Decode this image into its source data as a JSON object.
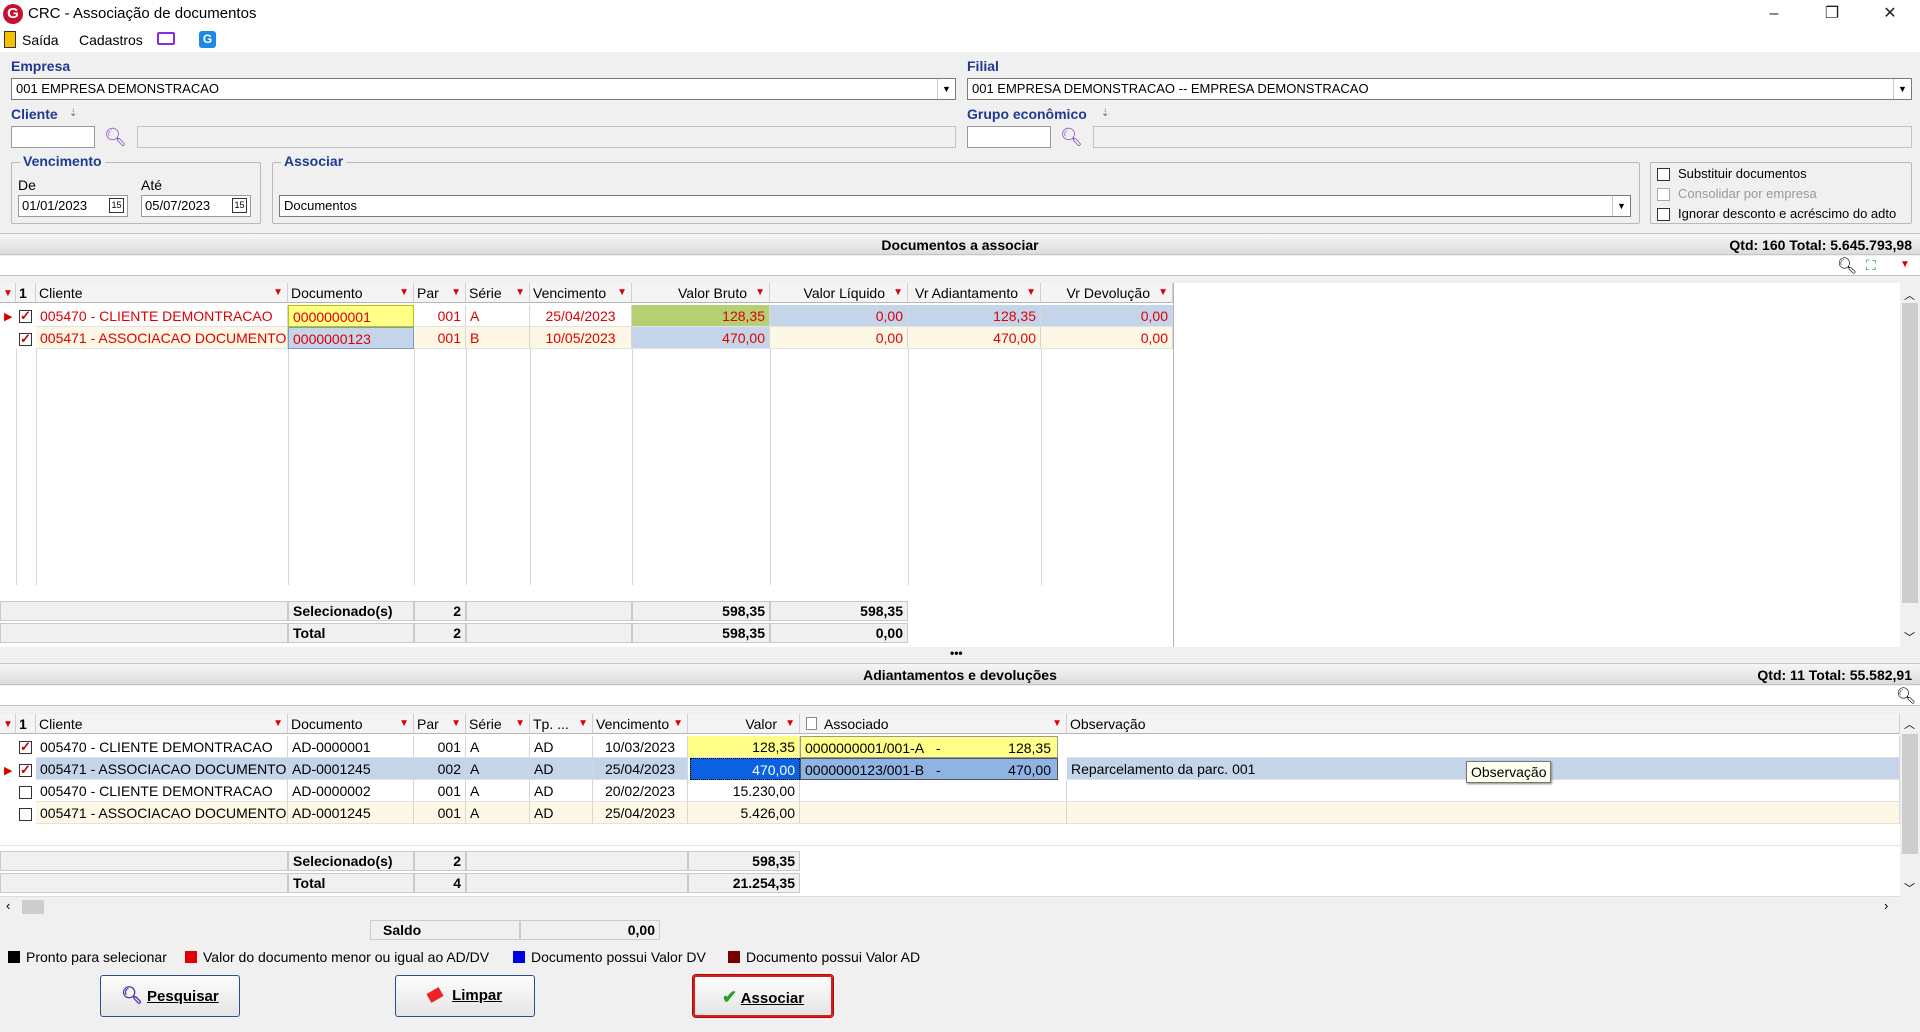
{
  "window": {
    "title": "CRC - Associação de documentos",
    "logo": "G"
  },
  "menu": {
    "saida": "Saída",
    "cadastros": "Cadastros"
  },
  "empresa": {
    "label": "Empresa",
    "value": "001 EMPRESA DEMONSTRACAO"
  },
  "filial": {
    "label": "Filial",
    "value": "001 EMPRESA DEMONSTRACAO -- EMPRESA DEMONSTRACAO"
  },
  "cliente": {
    "label": "Cliente"
  },
  "grupo": {
    "label": "Grupo econômico"
  },
  "vencimento": {
    "label": "Vencimento",
    "de_label": "De",
    "ate_label": "Até",
    "de": "01/01/2023",
    "ate": "05/07/2023"
  },
  "associar": {
    "label": "Associar",
    "value": "Documentos"
  },
  "options": {
    "substituir": "Substituir documentos",
    "consolidar": "Consolidar por empresa",
    "ignorar": "Ignorar desconto e acréscimo do adto"
  },
  "docs": {
    "title": "Documentos a associar",
    "summary": "Qtd: 160 Total: 5.645.793,98",
    "columns": {
      "num": "1",
      "cliente": "Cliente",
      "documento": "Documento",
      "par": "Par",
      "serie": "Série",
      "vencimento": "Vencimento",
      "valor_bruto": "Valor Bruto",
      "valor_liquido": "Valor Líquido",
      "vr_adiantamento": "Vr Adiantamento",
      "vr_devolucao": "Vr Devolução"
    },
    "rows": [
      {
        "cliente": "005470 - CLIENTE DEMONTRACAO",
        "documento": "0000000001",
        "par": "001",
        "serie": "A",
        "vencimento": "25/04/2023",
        "valor_bruto": "128,35",
        "valor_liquido": "0,00",
        "vr_adiantamento": "128,35",
        "vr_devolucao": "0,00"
      },
      {
        "cliente": "005471 - ASSOCIACAO DOCUMENTO",
        "documento": "0000000123",
        "par": "001",
        "serie": "B",
        "vencimento": "10/05/2023",
        "valor_bruto": "470,00",
        "valor_liquido": "0,00",
        "vr_adiantamento": "470,00",
        "vr_devolucao": "0,00"
      }
    ],
    "footer": {
      "sel_label": "Selecionado(s)",
      "sel_count": "2",
      "sel_bruto": "598,35",
      "sel_liquido": "598,35",
      "tot_label": "Total",
      "tot_count": "2",
      "tot_bruto": "598,35",
      "tot_liquido": "0,00"
    }
  },
  "splitter": "•••",
  "adt": {
    "title": "Adiantamentos e devoluções",
    "summary": "Qtd: 11 Total: 55.582,91",
    "columns": {
      "num": "1",
      "cliente": "Cliente",
      "documento": "Documento",
      "par": "Par",
      "serie": "Série",
      "tp": "Tp. ...",
      "vencimento": "Vencimento",
      "valor": "Valor",
      "associado": "Associado",
      "observacao": "Observação"
    },
    "rows": [
      {
        "cliente": "005470 - CLIENTE DEMONTRACAO",
        "documento": "AD-0000001",
        "par": "001",
        "serie": "A",
        "tp": "AD",
        "vencimento": "10/03/2023",
        "valor": "128,35",
        "associado": "0000000001/001-A",
        "sep": "-",
        "assoc_valor": "128,35",
        "observacao": ""
      },
      {
        "cliente": "005471 - ASSOCIACAO DOCUMENTO",
        "documento": "AD-0001245",
        "par": "002",
        "serie": "A",
        "tp": "AD",
        "vencimento": "25/04/2023",
        "valor": "470,00",
        "associado": "0000000123/001-B",
        "sep": "-",
        "assoc_valor": "470,00",
        "observacao": "Reparcelamento da parc. 001"
      },
      {
        "cliente": "005470 - CLIENTE DEMONTRACAO",
        "documento": "AD-0000002",
        "par": "001",
        "serie": "A",
        "tp": "AD",
        "vencimento": "20/02/2023",
        "valor": "15.230,00",
        "associado": "",
        "sep": "",
        "assoc_valor": "",
        "observacao": ""
      },
      {
        "cliente": "005471 - ASSOCIACAO DOCUMENTO",
        "documento": "AD-0001245",
        "par": "001",
        "serie": "A",
        "tp": "AD",
        "vencimento": "25/04/2023",
        "valor": "5.426,00",
        "associado": "",
        "sep": "",
        "assoc_valor": "",
        "observacao": ""
      }
    ],
    "footer": {
      "sel_label": "Selecionado(s)",
      "sel_count": "2",
      "sel_valor": "598,35",
      "tot_label": "Total",
      "tot_count": "4",
      "tot_valor": "21.254,35"
    },
    "tooltip": "Observação"
  },
  "saldo": {
    "label": "Saldo",
    "value": "0,00"
  },
  "legend": [
    {
      "color": "#000000",
      "text": "Pronto para selecionar"
    },
    {
      "color": "#e00000",
      "text": "Valor do documento menor ou igual ao AD/DV"
    },
    {
      "color": "#0000e0",
      "text": "Documento possui Valor DV"
    },
    {
      "color": "#7a0000",
      "text": "Documento possui Valor AD"
    }
  ],
  "buttons": {
    "pesquisar": "Pesquisar",
    "limpar": "Limpar",
    "associar": "Associar"
  }
}
